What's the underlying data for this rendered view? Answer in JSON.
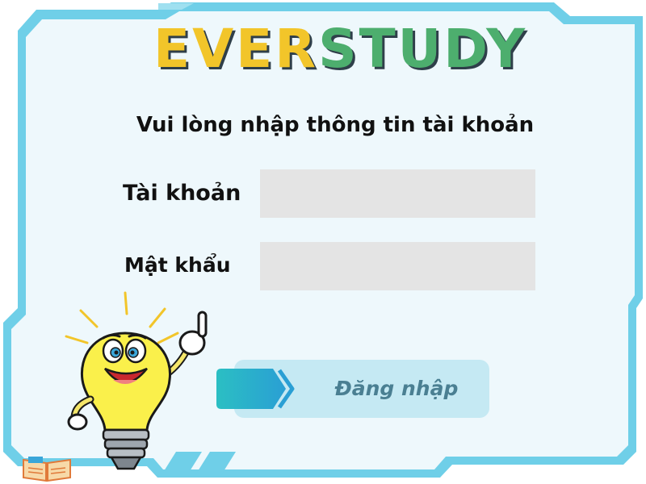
{
  "brand": {
    "ever": "EVER",
    "study": "STUDY",
    "colors": {
      "ever": "#F2C52A",
      "study": "#4DAE6E",
      "frame": "#6FCFE8",
      "panel": "#EEF8FC",
      "button": "#C5E9F3",
      "button_accent": "#2BBFC3"
    }
  },
  "login": {
    "heading": "Vui lòng nhập thông tin tài khoản",
    "username_label": "Tài khoản",
    "username_value": "",
    "password_label": "Mật khẩu",
    "password_value": "",
    "submit_label": "Đăng nhập"
  },
  "icons": {
    "mascot": "lightbulb-mascot-icon",
    "book": "open-book-icon",
    "button_arrow": "chevron-right-icon"
  }
}
